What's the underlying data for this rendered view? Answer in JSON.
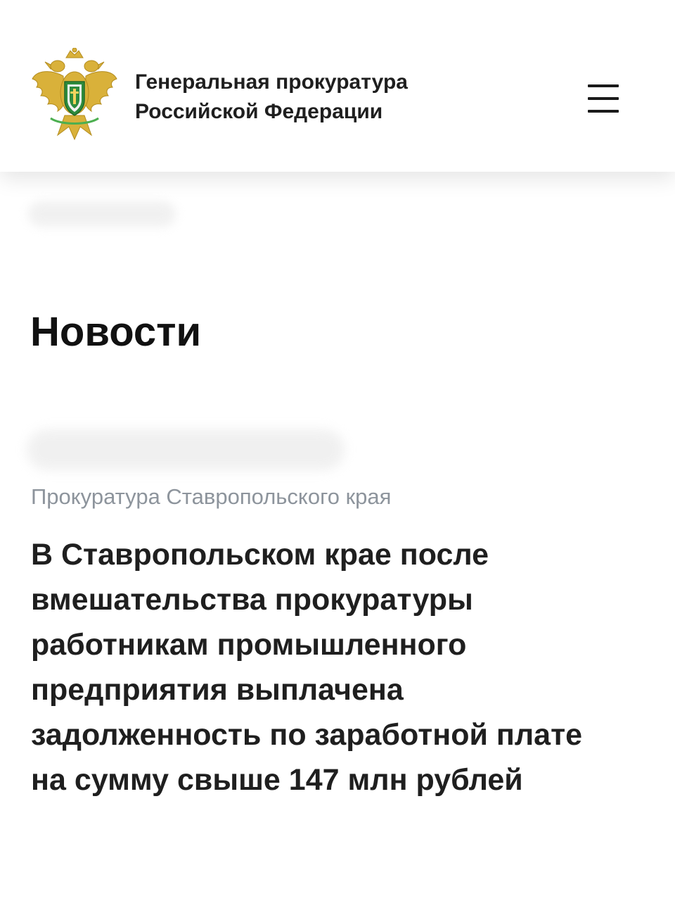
{
  "header": {
    "org_name_line1": "Генеральная прокуратура",
    "org_name_line2": "Российской Федерации",
    "logo_icon": "coat-of-arms-emblem",
    "menu_icon": "hamburger-menu-icon"
  },
  "page": {
    "title": "Новости"
  },
  "news_item": {
    "source": "Прокуратура Ставропольского края",
    "headline_lines": [
      "В Ставропольском крае после",
      "вмешательства прокуратуры",
      "работникам промышленного",
      "предприятия выплачена",
      "задолженность по заработной плате",
      "на сумму свыше 147 млн рублей"
    ]
  },
  "colors": {
    "emblem_gold": "#d9b13a",
    "emblem_green": "#2e8b3d",
    "source_text": "#8d949c",
    "text": "#1f1f1f"
  }
}
